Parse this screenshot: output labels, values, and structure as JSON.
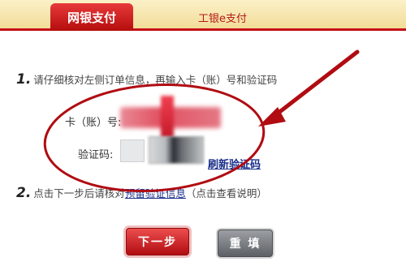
{
  "tabs": {
    "active": "网银支付",
    "inactive": "工银e支付"
  },
  "steps": {
    "step1_num": "1.",
    "step1_text": "请仔细核对左侧订单信息，再输入卡（账）号和验证码",
    "step2_num": "2.",
    "step2_text_before": "点击下一步后请核对",
    "step2_link": "预留验证信息",
    "step2_text_after": "（点击查看说明）"
  },
  "form": {
    "card_label": "卡（账）号:",
    "code_label": "验证码:",
    "refresh_link": "刷新验证码"
  },
  "buttons": {
    "next": "下一步",
    "reset": "重 填"
  },
  "colors": {
    "brand_red": "#c40f16",
    "tab_bar": "#f2dc98",
    "link": "#1a2f8a",
    "annotation": "#b00c12"
  },
  "icons": {
    "annotation_arrow": "arrow-icon",
    "annotation_oval": "oval-highlight"
  }
}
